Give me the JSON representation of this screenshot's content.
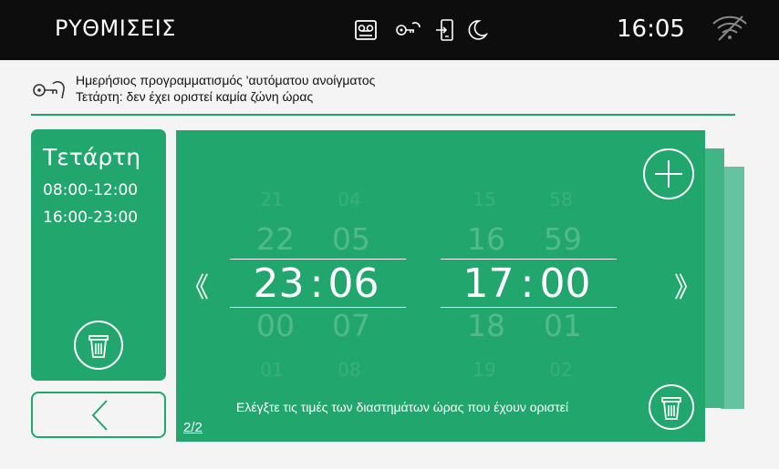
{
  "status_bar": {
    "title": "ΡΥΘΜΙΣΕΙΣ",
    "time": "16:05",
    "icons": [
      "voicemail-icon",
      "key-icon",
      "door-phone-icon",
      "moon-icon",
      "wifi-off-icon"
    ]
  },
  "info": {
    "line1": "Ημερήσιος προγραμματισμός 'αυτόματου ανοίγματος",
    "line2": "Τετάρτη: δεν έχει οριστεί καμία ζώνη ώρας"
  },
  "day_card": {
    "day": "Τετάρτη",
    "intervals": [
      "08:00-12:00",
      "16:00-23:00"
    ]
  },
  "picker": {
    "start": {
      "hours": [
        "21",
        "22",
        "23",
        "00",
        "01"
      ],
      "minutes": [
        "04",
        "05",
        "06",
        "07",
        "08"
      ],
      "sep": ":"
    },
    "end": {
      "hours": [
        "15",
        "16",
        "17",
        "18",
        "19"
      ],
      "minutes": [
        "58",
        "59",
        "00",
        "01",
        "02"
      ],
      "sep": ":"
    },
    "prev_arrow": "《",
    "next_arrow": "》",
    "message": "Ελέγξτε τις τιμές των διαστημάτων ώρας που έχουν οριστεί",
    "page": "2/2"
  },
  "colors": {
    "accent": "#21a66d",
    "topbar": "#0d0d0d",
    "background": "#f4f4f4"
  }
}
